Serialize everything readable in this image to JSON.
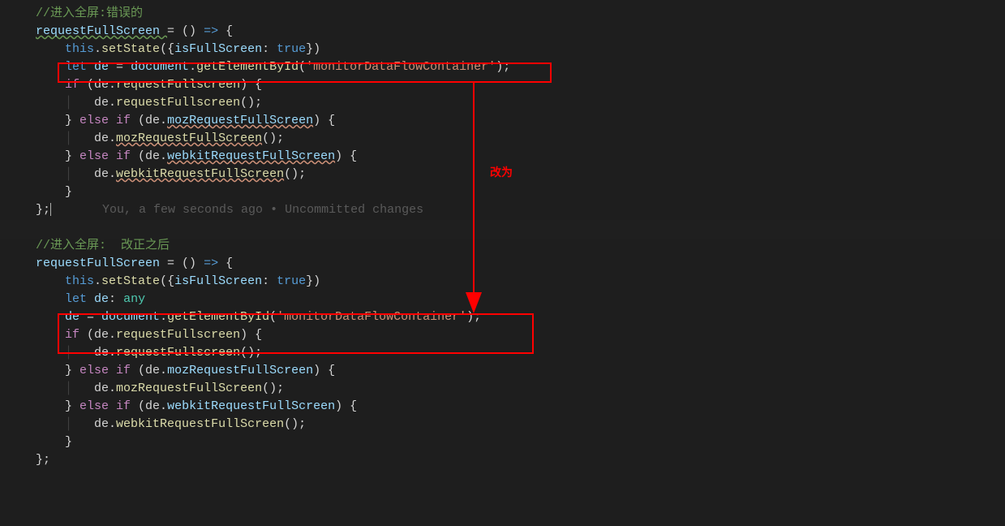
{
  "code_block_1": {
    "comment": "//进入全屏:错误的",
    "l2_a": "requestFullScreen ",
    "l2_b": "=",
    "l2_c": " () ",
    "l2_d": "=>",
    "l2_e": " {",
    "l3_a": "this",
    "l3_b": ".",
    "l3_c": "setState",
    "l3_d": "({",
    "l3_e": "isFullScreen",
    "l3_f": ": ",
    "l3_g": "true",
    "l3_h": "})",
    "l4_a": "let",
    "l4_b": " de ",
    "l4_c": "=",
    "l4_d": " document",
    "l4_e": ".",
    "l4_f": "getElementById",
    "l4_g": "(",
    "l4_h": "'monitorDataFlowContainer'",
    "l4_i": ");",
    "l5_a": "if",
    "l5_b": " (de.",
    "l5_c": "requestFullscreen",
    "l5_d": ") {",
    "l6_a": "de.",
    "l6_b": "requestFullscreen",
    "l6_c": "();",
    "l7_a": "} ",
    "l7_b": "else if",
    "l7_c": " (de.",
    "l7_d": "mozRequestFullScreen",
    "l7_e": ") {",
    "l8_a": "de.",
    "l8_b": "mozRequestFullScreen",
    "l8_c": "();",
    "l9_a": "} ",
    "l9_b": "else if",
    "l9_c": " (de.",
    "l9_d": "webkitRequestFullScreen",
    "l9_e": ") {",
    "l10_a": "de.",
    "l10_b": "webkitRequestFullScreen",
    "l10_c": "();",
    "l11": "}",
    "l12": "};",
    "gitlens": "You, a few seconds ago • Uncommitted changes"
  },
  "code_block_2": {
    "comment": "//进入全屏:  改正之后",
    "l2_a": "requestFullScreen ",
    "l2_b": "=",
    "l2_c": " () ",
    "l2_d": "=>",
    "l2_e": " {",
    "l3_a": "this",
    "l3_b": ".",
    "l3_c": "setState",
    "l3_d": "({",
    "l3_e": "isFullScreen",
    "l3_f": ": ",
    "l3_g": "true",
    "l3_h": "})",
    "l4_a": "let",
    "l4_b": " de",
    "l4_c": ": ",
    "l4_d": "any",
    "l5_a": "de ",
    "l5_b": "=",
    "l5_c": " document",
    "l5_d": ".",
    "l5_e": "getElementById",
    "l5_f": "(",
    "l5_g": "'monitorDataFlowContainer'",
    "l5_h": ");",
    "l6_a": "if",
    "l6_b": " (de.",
    "l6_c": "requestFullscreen",
    "l6_d": ") {",
    "l7_a": "de.",
    "l7_b": "requestFullscreen",
    "l7_c": "();",
    "l8_a": "} ",
    "l8_b": "else if",
    "l8_c": " (de.",
    "l8_d": "mozRequestFullScreen",
    "l8_e": ") {",
    "l9_a": "de.",
    "l9_b": "mozRequestFullScreen",
    "l9_c": "();",
    "l10_a": "} ",
    "l10_b": "else if",
    "l10_c": " (de.",
    "l10_d": "webkitRequestFullScreen",
    "l10_e": ") {",
    "l11_a": "de.",
    "l11_b": "webkitRequestFullScreen",
    "l11_c": "();",
    "l12": "}",
    "l13": "};"
  },
  "annotation_label": "改为"
}
